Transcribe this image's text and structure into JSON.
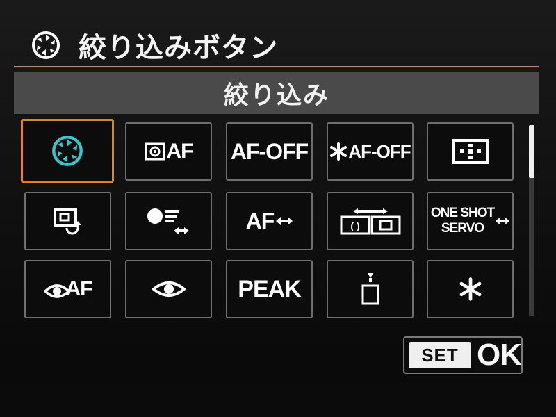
{
  "header": {
    "title": "絞り込みボタン",
    "icon": "aperture-icon"
  },
  "subheader": {
    "label": "絞り込み"
  },
  "accent_color": "#e0821e",
  "selected_color": "#36c6c9",
  "functions": [
    {
      "id": "aperture",
      "icon": "aperture-icon",
      "selected": true
    },
    {
      "id": "metering-af-start",
      "icon": "metering-af-icon",
      "label": "AF"
    },
    {
      "id": "af-off",
      "label": "AF-OFF"
    },
    {
      "id": "ae-lock-af-off",
      "icon": "asterisk-icon",
      "label": "AF-OFF"
    },
    {
      "id": "af-point-select",
      "icon": "af-point-icon"
    },
    {
      "id": "switch-af-area",
      "icon": "af-area-switch-icon"
    },
    {
      "id": "tracking-switch",
      "icon": "tracking-icon"
    },
    {
      "id": "af-switch",
      "label": "AF",
      "icon": "double-arrow-icon"
    },
    {
      "id": "registered-af-point",
      "icon": "af-switch-frames-icon"
    },
    {
      "id": "one-shot-servo",
      "label_line1": "ONE SHOT",
      "label_line2": "SERVO",
      "icon": "double-arrow-icon"
    },
    {
      "id": "eye-af",
      "icon": "eye-icon",
      "label": "AF"
    },
    {
      "id": "eye-detection",
      "icon": "eye-icon"
    },
    {
      "id": "peaking",
      "label": "PEAK"
    },
    {
      "id": "level",
      "icon": "level-icon"
    },
    {
      "id": "ae-lock",
      "icon": "asterisk-icon"
    }
  ],
  "footer": {
    "set_label": "SET",
    "ok_label": "OK"
  },
  "scroll": {
    "position": 0.0,
    "visible_fraction": 0.28
  }
}
